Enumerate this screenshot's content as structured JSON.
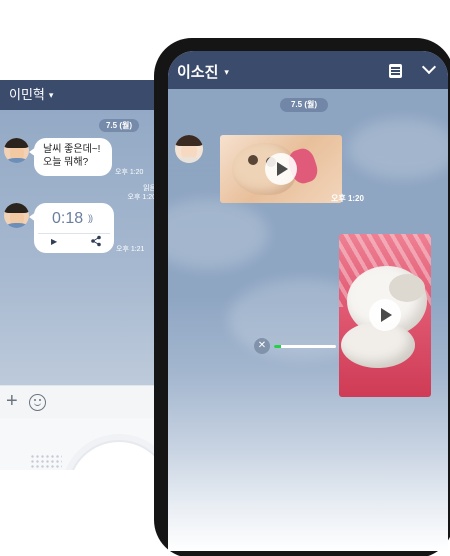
{
  "back_phone": {
    "contact_name": "이민혁",
    "caret": "▾",
    "date_badge": "7.5 (월)",
    "text_message": {
      "line1": "날씨 좋은데~!",
      "line2": "오늘 뭐해?",
      "time": "오후 1:20"
    },
    "my_message_meta": {
      "status": "읽음",
      "time": "오후 1:20"
    },
    "voice_message": {
      "duration": "0:18",
      "wave": "))",
      "play": "▶",
      "time": "오후 1:21"
    },
    "input_bar": {
      "plus": "+"
    }
  },
  "front_phone": {
    "contact_name": "이소진",
    "caret": "▾",
    "date_badge": "7.5 (월)",
    "photo_message": {
      "time": "오후 1:20"
    },
    "upload": {
      "cancel": "✕",
      "progress": 0.12
    }
  },
  "colors": {
    "header": "#3b4b6b",
    "progress": "#27d146"
  }
}
